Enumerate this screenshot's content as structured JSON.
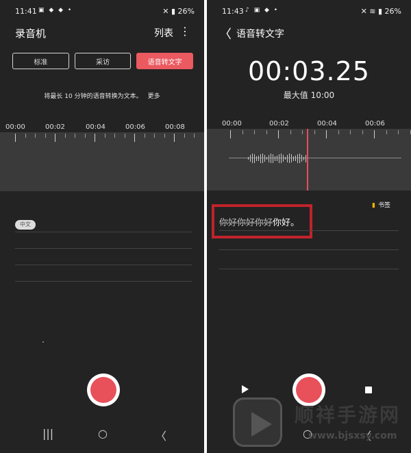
{
  "left_screen": {
    "status": {
      "time": "11:41",
      "icons": "▣ ◆ ◆ •",
      "battery": "✕ ▮ 26%"
    },
    "title": "录音机",
    "list_label": "列表",
    "menu_glyph": "⋮",
    "modes": [
      "标准",
      "采访",
      "语音转文字"
    ],
    "active_mode": "语音转文字",
    "hint": "将最长 10 分钟的语音转换为文本。",
    "more": "更多",
    "timeline": [
      "00:00",
      "00:02",
      "00:04",
      "00:06",
      "00:08"
    ],
    "chip": "中文"
  },
  "right_screen": {
    "status": {
      "time": "11:43",
      "icons": "♪ ▣ ◆ •",
      "battery": "✕ ≋ ▮ 26%"
    },
    "back_glyph": "〈",
    "title": "语音转文字",
    "elapsed": "00:03.25",
    "max_duration": "最大值 10:00",
    "timeline": [
      "00:00",
      "00:02",
      "00:04",
      "00:06"
    ],
    "bookmark_label": "书签",
    "transcript_struck": "你好你好你好",
    "transcript_tail": "你好。"
  },
  "nav_glyphs": {
    "recents": "|||",
    "home": "○",
    "back": "〈"
  },
  "watermark": {
    "title": "顺祥手游网",
    "url": "www.bjsxsy.com"
  },
  "colors": {
    "accent": "#ea5a60",
    "record": "#e8505a",
    "highlight_box": "#c0232b",
    "bookmark": "#f5b400",
    "background": "#232323"
  }
}
